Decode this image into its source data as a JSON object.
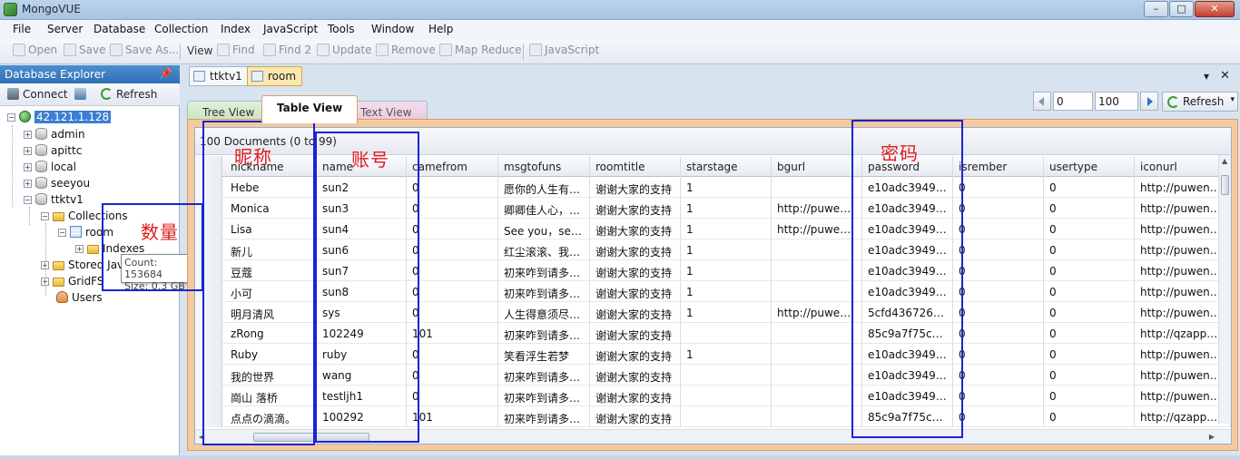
{
  "window": {
    "title": "MongoVUE",
    "min": "–",
    "max": "□",
    "close": "✕"
  },
  "menu": [
    "File",
    "Server",
    "Database",
    "Collection",
    "Index",
    "JavaScript",
    "Tools",
    "Window",
    "Help"
  ],
  "toolbar": {
    "open": "Open",
    "save": "Save",
    "save_as": "Save As...",
    "view_label": "View",
    "find": "Find",
    "find2": "Find 2",
    "update": "Update",
    "remove": "Remove",
    "map_reduce": "Map Reduce",
    "javascript": "JavaScript"
  },
  "explorer": {
    "title": "Database Explorer",
    "pin": "📌",
    "connect": "Connect",
    "refresh": "Refresh",
    "tree": {
      "server": "42.121.1.128",
      "databases": [
        "admin",
        "apittc",
        "local",
        "seeyou",
        "ttktv1"
      ],
      "collections": "Collections",
      "room": "room",
      "indexes": "Indexes",
      "stored": "Stored Javascript",
      "gridfs": "GridFS",
      "users": "Users"
    },
    "tooltip": {
      "count": "Count: 153684",
      "size": "Size: 0.3 GB"
    }
  },
  "doc_tabs": [
    "ttktv1",
    "room"
  ],
  "pager": {
    "skip": "0",
    "limit": "100",
    "refresh": "Refresh"
  },
  "view_tabs": [
    "Tree View",
    "Table View",
    "Text View"
  ],
  "table": {
    "doc_count": "100 Documents (0 to 99)",
    "columns": [
      "nickname",
      "name",
      "camefrom",
      "msgtofuns",
      "roomtitle",
      "starstage",
      "bgurl",
      "password",
      "isrember",
      "usertype",
      "iconurl"
    ],
    "rows": [
      [
        "Hebe",
        "sun2",
        "0",
        "愿你的人生有…",
        "谢谢大家的支持",
        "1",
        "",
        "e10adc3949ba…",
        "0",
        "0",
        "http://puwenz…"
      ],
      [
        "Monica",
        "sun3",
        "0",
        "卿卿佳人心，…",
        "谢谢大家的支持",
        "1",
        "http://puwenz…",
        "e10adc3949ba…",
        "0",
        "0",
        "http://puwenz…"
      ],
      [
        "Lisa",
        "sun4",
        "0",
        "See you，see …",
        "谢谢大家的支持",
        "1",
        "http://puwenz…",
        "e10adc3949ba…",
        "0",
        "0",
        "http://puwenz…"
      ],
      [
        "新儿",
        "sun6",
        "0",
        "红尘滚滚、我…",
        "谢谢大家的支持",
        "1",
        "",
        "e10adc3949ba…",
        "0",
        "0",
        "http://puwenz…"
      ],
      [
        "豆蔻",
        "sun7",
        "0",
        "初来咋到请多…",
        "谢谢大家的支持",
        "1",
        "",
        "e10adc3949ba…",
        "0",
        "0",
        "http://puwenz…"
      ],
      [
        "小可",
        "sun8",
        "0",
        "初来咋到请多…",
        "谢谢大家的支持",
        "1",
        "",
        "e10adc3949ba…",
        "0",
        "0",
        "http://puwenz…"
      ],
      [
        "明月清风",
        "sys",
        "0",
        "人生得意须尽…",
        "谢谢大家的支持",
        "1",
        "http://puwenz…",
        "5cfd4367263e2…",
        "0",
        "0",
        "http://puwenz…"
      ],
      [
        "zRong",
        "102249",
        "101",
        "初来咋到请多…",
        "谢谢大家的支持",
        "",
        "",
        "85c9a7f75cb3e…",
        "0",
        "0",
        "http://qzapp.q…"
      ],
      [
        "Ruby",
        "ruby",
        "0",
        "笑看浮生若梦",
        "谢谢大家的支持",
        "1",
        "",
        "e10adc3949ba…",
        "0",
        "0",
        "http://puwenz…"
      ],
      [
        "我的世界",
        "wang",
        "0",
        "初来咋到请多…",
        "谢谢大家的支持",
        "",
        "",
        "e10adc3949ba…",
        "0",
        "0",
        "http://puwenz…"
      ],
      [
        "崗山 落桥",
        "testljh1",
        "0",
        "初来咋到请多…",
        "谢谢大家的支持",
        "",
        "",
        "e10adc3949ba…",
        "0",
        "0",
        "http://puwenz…"
      ],
      [
        "点点の滴滴。",
        "100292",
        "101",
        "初来咋到请多…",
        "谢谢大家的支持",
        "",
        "",
        "85c9a7f75cb3e…",
        "0",
        "0",
        "http://qzapp.q…"
      ]
    ]
  },
  "annotations": {
    "nickname": "昵称",
    "account": "账号",
    "password": "密码",
    "count": "数量"
  },
  "colors": {
    "annotation_box": "#1a23d6",
    "annotation_text": "#e01b1b",
    "selection": "#3a7fd0"
  }
}
